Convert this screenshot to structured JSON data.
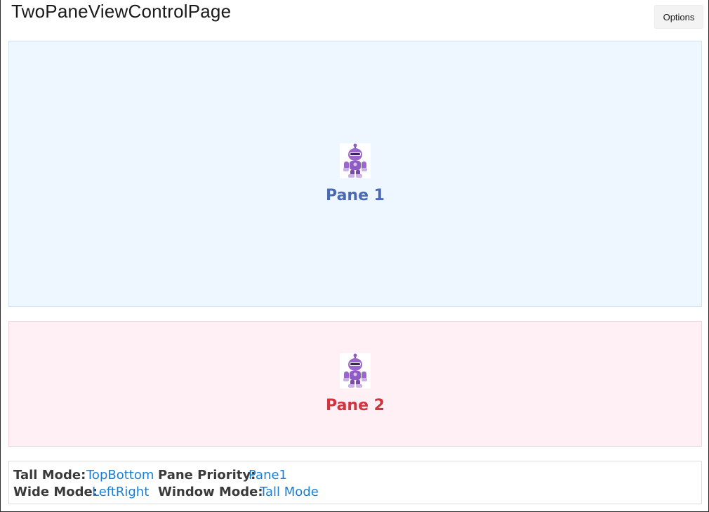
{
  "header": {
    "title": "TwoPaneViewControlPage",
    "options_label": "Options"
  },
  "panes": [
    {
      "label": "Pane 1",
      "image_icon": "bot-mascot-icon",
      "background": "#eef7ff",
      "label_color": "#4a6ab4"
    },
    {
      "label": "Pane 2",
      "image_icon": "bot-mascot-icon",
      "background": "#fff0f5",
      "label_color": "#d1343f"
    }
  ],
  "status": {
    "tall_mode_label": "Tall Mode:",
    "tall_mode_value": "TopBottom",
    "pane_priority_label": "Pane Priority:",
    "pane_priority_value": "Pane1",
    "wide_mode_label": "Wide Mode:",
    "wide_mode_value": "LeftRight",
    "window_mode_label": "Window Mode:",
    "window_mode_value": "Tall Mode",
    "value_color": "#1a7fd4"
  }
}
